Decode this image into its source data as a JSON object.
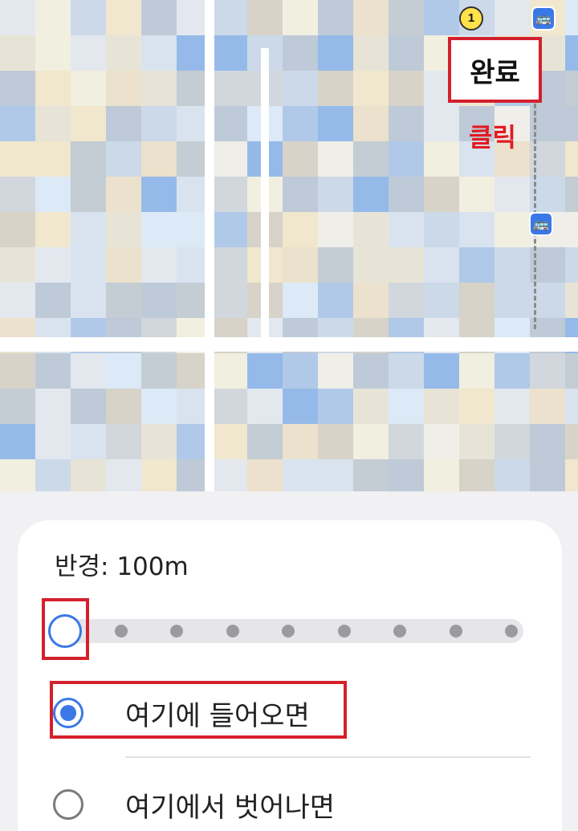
{
  "map": {
    "poi_badge": "1",
    "bus_icon_name": "bus-stop-icon",
    "colors": {
      "route": "#8a8a8a",
      "bus": "#3b78e7",
      "poi": "#ffe14a"
    }
  },
  "header": {
    "done_label": "완료",
    "click_annotation": "클릭"
  },
  "geofence": {
    "radius_label": "반경: 100m",
    "radius_meters": 100,
    "slider_steps": 9,
    "slider_position": 0,
    "options": [
      {
        "label": "여기에 들어오면",
        "selected": true
      },
      {
        "label": "여기에서 벗어나면",
        "selected": false
      }
    ]
  },
  "annotation_color": "#d4202c",
  "accent_color": "#3b78e7"
}
